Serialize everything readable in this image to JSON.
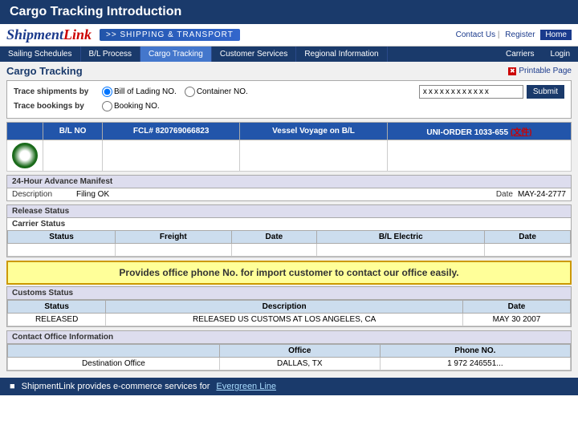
{
  "header": {
    "title": "Cargo Tracking Introduction"
  },
  "logo": {
    "text": "ShipmentLink",
    "shipping_badge": ">> SHIPPING & TRANSPORT"
  },
  "top_links": {
    "contact": "Contact Us",
    "register": "Register",
    "divider": "|",
    "home": "Home"
  },
  "nav": {
    "items": [
      {
        "label": "Sailing Schedules",
        "active": false
      },
      {
        "label": "B/L Process",
        "active": false
      },
      {
        "label": "Cargo Tracking",
        "active": true
      },
      {
        "label": "Customer Services",
        "active": false
      },
      {
        "label": "Regional Information",
        "active": false
      }
    ],
    "right_items": [
      {
        "label": "Carriers"
      },
      {
        "label": "Login"
      }
    ]
  },
  "page": {
    "title": "Cargo Tracking",
    "printable": "Printable Page"
  },
  "search": {
    "trace_by_label": "Trace shipments by",
    "radio1": "Bill of Lading NO.",
    "radio2": "Container NO.",
    "trace_by_label2": "Trace bookings by",
    "radio3": "Booking NO.",
    "input_value": "xxxxxxxxxxxx",
    "submit": "Submit"
  },
  "result": {
    "col1": "B/L NO",
    "col2": "FCL# 820769066823",
    "col3": "Vessel Voyage on B/L",
    "col3_value": "Vessel Voyage on B/L",
    "col4": "UNI-ORDER 1033-655",
    "col4_detail": "(文件)",
    "logo_symbol": "✿"
  },
  "manifest": {
    "header": "24-Hour Advance Manifest",
    "desc_label": "Description",
    "desc_value": "Filing OK",
    "date_label": "Date",
    "date_value": "MAY-24-2777"
  },
  "release_status": {
    "header": "Release Status",
    "carrier_status_label": "Carrier Status",
    "columns": [
      "Status",
      "Freight",
      "Date",
      "B/L Electric",
      "Date"
    ],
    "rows": []
  },
  "highlight": {
    "text": "Provides office phone No. for import customer to contact our office easily."
  },
  "customs": {
    "header": "Customs Status",
    "columns": [
      "Status",
      "Description",
      "Date"
    ],
    "rows": [
      {
        "status": "RELEASED",
        "description": "RELEASED US CUSTOMS AT LOS ANGELES, CA",
        "date": "MAY 30 2007"
      }
    ]
  },
  "contact": {
    "header": "Contact Office Information",
    "columns": [
      "Office",
      "Phone NO."
    ],
    "rows": [
      {
        "description": "Destination Office",
        "office": "DALLAS, TX",
        "phone": "1 972 246551..."
      }
    ]
  },
  "bottom": {
    "bullet": "■",
    "text": "ShipmentLink provides e-commerce services for",
    "link": "Evergreen Line"
  }
}
